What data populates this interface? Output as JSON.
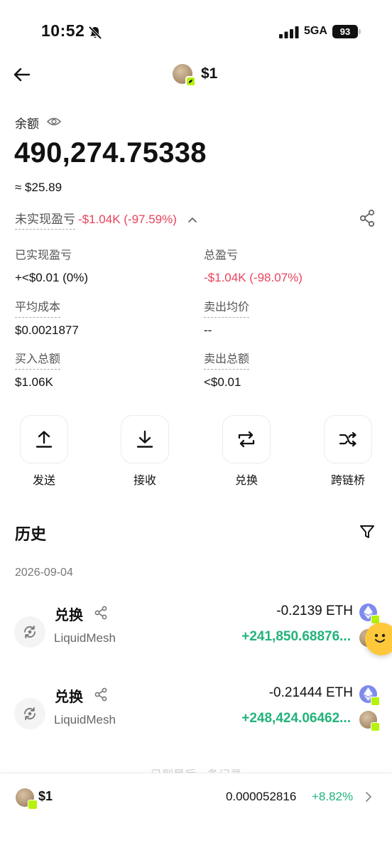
{
  "status_bar": {
    "time": "10:52",
    "network": "5GA",
    "battery": "93"
  },
  "header": {
    "title": "$1"
  },
  "balance": {
    "label": "余额",
    "amount": "490,274.75338",
    "usd": "≈ $25.89"
  },
  "pnl": {
    "unrealized_label": "未实现盈亏",
    "unrealized_value": "-$1.04K (-97.59%)"
  },
  "stats": {
    "realized_label": "已实现盈亏",
    "realized_value": "+<$0.01 (0%)",
    "total_label": "总盈亏",
    "total_value": "-$1.04K (-98.07%)",
    "avg_cost_label": "平均成本",
    "avg_cost_value": "$0.0021877",
    "avg_sell_label": "卖出均价",
    "avg_sell_value": "--",
    "buy_total_label": "买入总额",
    "buy_total_value": "$1.06K",
    "sell_total_label": "卖出总额",
    "sell_total_value": "<$0.01"
  },
  "actions": [
    {
      "label": "发送",
      "icon": "upload-icon"
    },
    {
      "label": "接收",
      "icon": "download-icon"
    },
    {
      "label": "兑换",
      "icon": "swap-icon"
    },
    {
      "label": "跨链桥",
      "icon": "bridge-icon"
    }
  ],
  "history": {
    "title": "历史",
    "date": "2026-09-04",
    "transactions": [
      {
        "type": "兑换",
        "platform": "LiquidMesh",
        "out": "-0.2139 ETH",
        "in": "+241,850.68876..."
      },
      {
        "type": "兑换",
        "platform": "LiquidMesh",
        "out": "-0.21444 ETH",
        "in": "+248,424.06462..."
      }
    ],
    "end_note": "已到最后一条记录"
  },
  "bottom_bar": {
    "title": "$1",
    "price": "0.000052816",
    "change": "+8.82%"
  },
  "colors": {
    "negative": "#e8435a",
    "positive": "#22b37a",
    "badge": "#b6f20a",
    "eth": "#7f8bec"
  }
}
